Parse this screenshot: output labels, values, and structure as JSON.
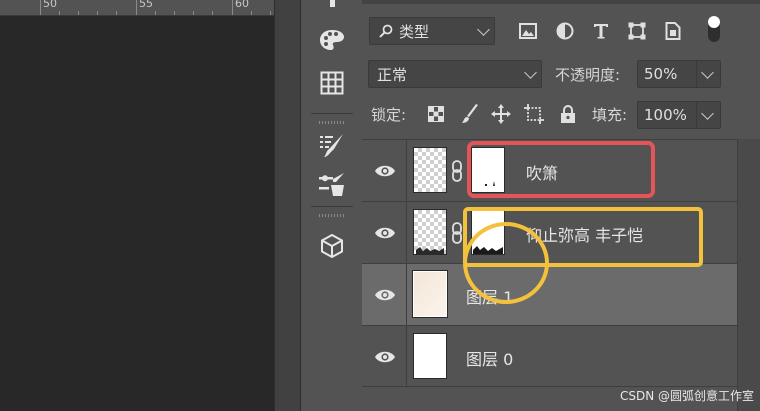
{
  "ruler": {
    "labels": [
      "50",
      "55",
      "60"
    ]
  },
  "filter": {
    "kind_label": "类型"
  },
  "blend": {
    "mode": "正常",
    "opacity_label": "不透明度:",
    "opacity_value": "50%"
  },
  "lock": {
    "label": "锁定:",
    "fill_label": "填充:",
    "fill_value": "100%"
  },
  "layers": [
    {
      "name": "吹箫",
      "visible": true,
      "selected": false
    },
    {
      "name": "仰止弥高 丰子恺",
      "visible": true,
      "selected": false
    },
    {
      "name": "图层 1",
      "visible": true,
      "selected": true
    },
    {
      "name": "图层 0",
      "visible": true,
      "selected": false
    }
  ],
  "annotations": {
    "rect_color": "#e4555a",
    "highlight_color": "#f4c13d"
  },
  "watermark": "CSDN @圆弧创意工作室"
}
